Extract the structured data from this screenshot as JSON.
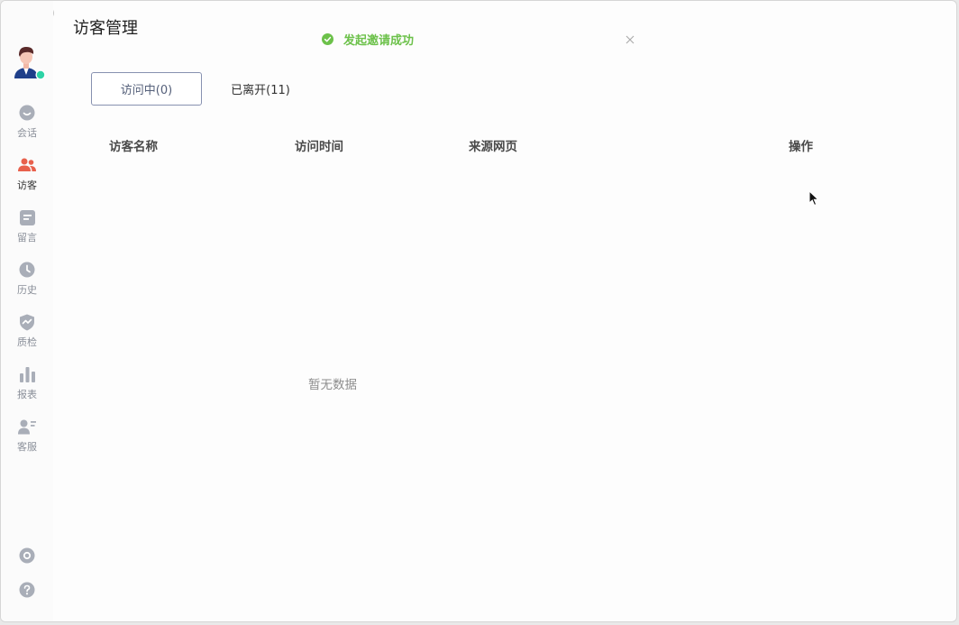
{
  "window": {
    "title": "访客管理"
  },
  "toast": {
    "message": "发起邀请成功",
    "status_color": "#6cc14a"
  },
  "sidebar": {
    "items": [
      {
        "label": "会话",
        "icon": "chat-bubble-icon",
        "active": false
      },
      {
        "label": "访客",
        "icon": "visitors-icon",
        "active": true
      },
      {
        "label": "留言",
        "icon": "message-icon",
        "active": false
      },
      {
        "label": "历史",
        "icon": "clock-icon",
        "active": false
      },
      {
        "label": "质检",
        "icon": "shield-check-icon",
        "active": false
      },
      {
        "label": "报表",
        "icon": "bar-chart-icon",
        "active": false
      },
      {
        "label": "客服",
        "icon": "agent-icon",
        "active": false
      }
    ],
    "bottom": [
      {
        "icon": "settings-icon"
      },
      {
        "icon": "help-icon"
      }
    ],
    "active_color": "#e8604c",
    "icon_color": "#a9aeb8",
    "online_status_color": "#2ed3a6"
  },
  "tabs": [
    {
      "label": "访问中(0)",
      "active": true
    },
    {
      "label": "已离开(11)",
      "active": false
    }
  ],
  "table": {
    "columns": [
      "访客名称",
      "访问时间",
      "来源网页",
      "操作"
    ],
    "rows": [],
    "empty_text": "暂无数据"
  }
}
